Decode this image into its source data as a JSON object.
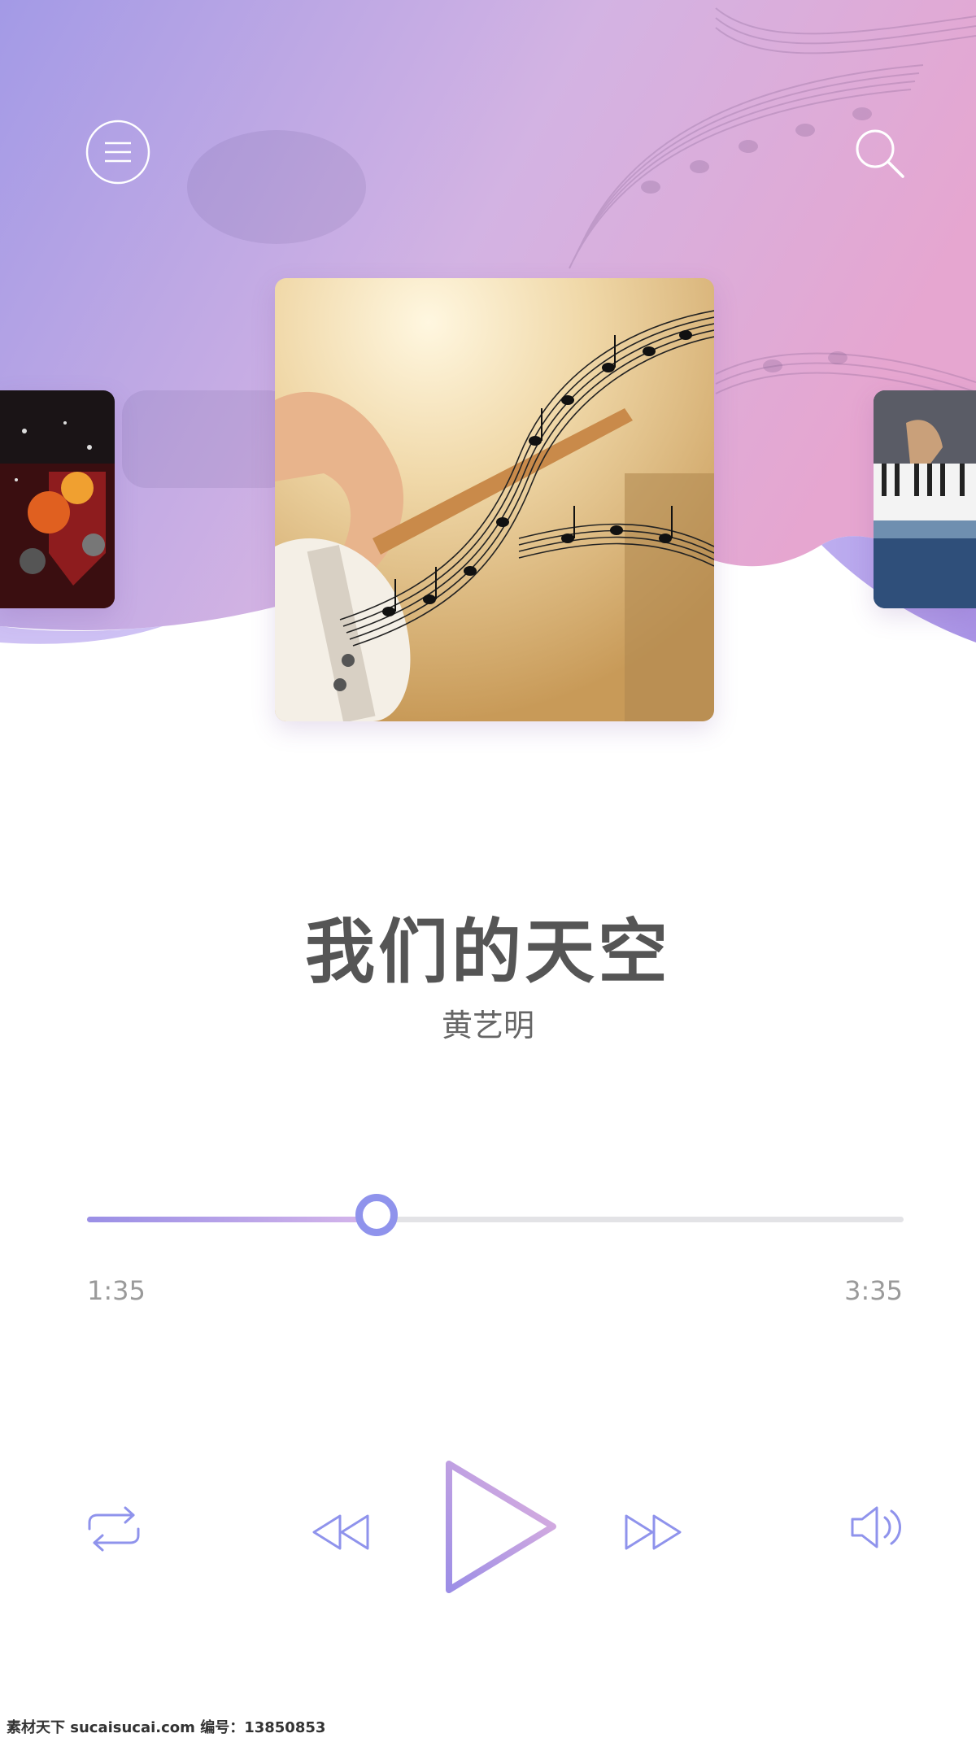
{
  "header": {
    "menu_icon": "menu-icon",
    "search_icon": "search-icon",
    "gradient": [
      "#a39ae6",
      "#d7b3e2",
      "#e9a9cf"
    ]
  },
  "carousel": {
    "left_cover": "drum-kit-album-cover",
    "main_cover": "guitar-music-notes-album-cover",
    "right_cover": "keyboard-player-album-cover"
  },
  "song": {
    "title": "我们的天空",
    "artist": "黄艺明"
  },
  "playback": {
    "current_time": "1:35",
    "total_time": "3:35",
    "progress": 0.355,
    "accent": "#8f93ec"
  },
  "controls": {
    "repeat_icon": "repeat-icon",
    "previous_icon": "rewind-icon",
    "play_icon": "play-icon",
    "next_icon": "fast-forward-icon",
    "volume_icon": "volume-icon"
  },
  "watermark": "素材天下 sucaisucai.com  编号：13850853"
}
